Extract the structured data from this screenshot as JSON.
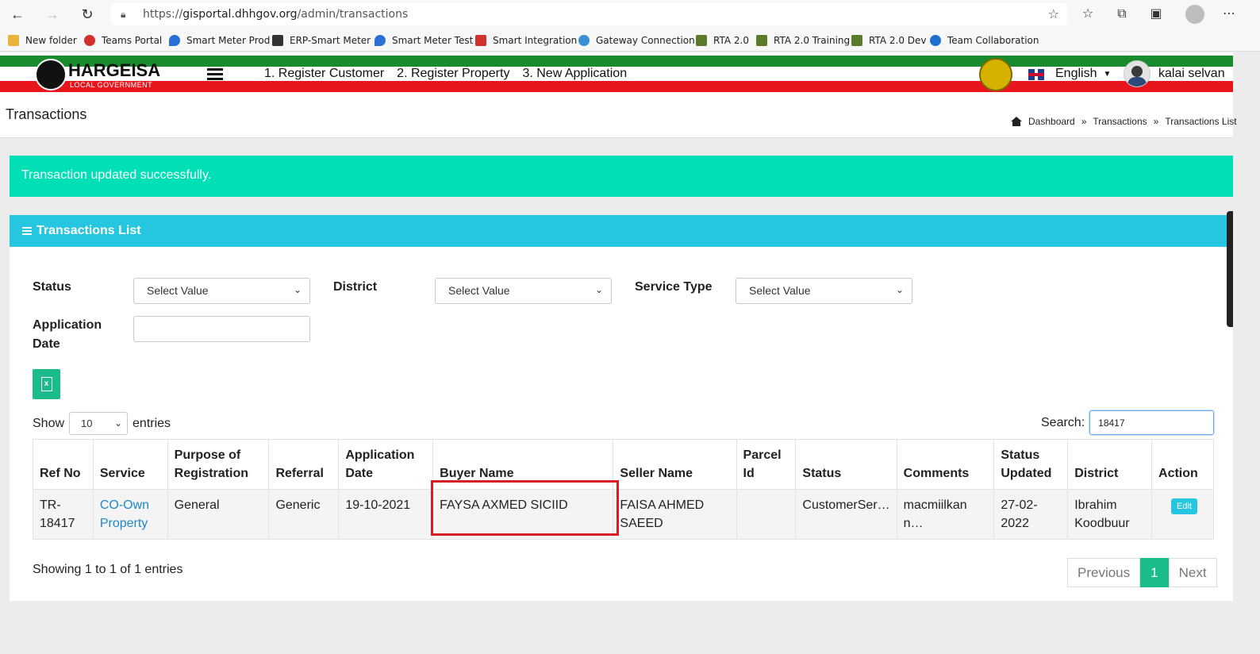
{
  "browser": {
    "url_prefix": "https://",
    "url_host": "gisportal.dhhgov.org",
    "url_path": "/admin/transactions",
    "bookmarks": [
      {
        "label": "New folder",
        "color": "#e8b43c"
      },
      {
        "label": "Teams Portal",
        "color": "#d0312d"
      },
      {
        "label": "Smart Meter Prod",
        "color": "#2a6fd6"
      },
      {
        "label": "ERP-Smart Meter",
        "color": "#333333"
      },
      {
        "label": "Smart Meter Test",
        "color": "#2a6fd6"
      },
      {
        "label": "Smart Integration",
        "color": "#d0312d"
      },
      {
        "label": "Gateway Connection",
        "color": "#3a8fd6"
      },
      {
        "label": "RTA 2.0",
        "color": "#5b7a2a"
      },
      {
        "label": "RTA 2.0 Training",
        "color": "#5b7a2a"
      },
      {
        "label": "RTA 2.0 Dev",
        "color": "#5b7a2a"
      },
      {
        "label": "Team Collaboration",
        "color": "#1e6fd0"
      }
    ]
  },
  "header": {
    "logo_title": "HARGEISA",
    "logo_subtitle": "LOCAL GOVERNMENT",
    "menu": [
      "1. Register Customer",
      "2. Register Property",
      "3. New Application"
    ],
    "language": "English",
    "user_name": "kalai selvan"
  },
  "page": {
    "title": "Transactions",
    "breadcrumb": [
      "Dashboard",
      "»",
      "Transactions",
      "»",
      "Transactions List"
    ]
  },
  "alert": {
    "message": "Transaction updated successfully.",
    "color": "#00dfb6"
  },
  "card": {
    "title": "Transactions List",
    "filters": {
      "status_label": "Status",
      "status_value": "Select Value",
      "district_label": "District",
      "district_value": "Select Value",
      "service_type_label": "Service Type",
      "service_type_value": "Select Value",
      "application_date_label_1": "Application",
      "application_date_label_2": "Date",
      "application_date_value": ""
    },
    "show_label": "Show",
    "show_value": "10",
    "entries_label": "entries",
    "search_label": "Search:",
    "search_value": "18417",
    "columns": [
      "Ref No",
      "Service",
      "Purpose of Registration",
      "Referral",
      "Application Date",
      "Buyer Name",
      "Seller Name",
      "Parcel Id",
      "Status",
      "Comments",
      "Status Updated",
      "District",
      "Action"
    ],
    "rows": [
      {
        "ref_no": "TR-18417",
        "service": "CO-Own Property",
        "purpose": "General",
        "referral": "Generic",
        "application_date": "19-10-2021",
        "buyer_name": "FAYSA AXMED SICIID",
        "seller_name": "FAISA AHMED SAEED",
        "parcel_id": "",
        "status": "CustomerSer…",
        "comments": "macmiilkan n…",
        "status_updated": "27-02-2022",
        "district": "Ibrahim Koodbuur",
        "action": "Edit"
      }
    ],
    "showing_text": "Showing 1 to 1 of 1 entries",
    "pager": {
      "previous": "Previous",
      "current": "1",
      "next": "Next"
    }
  }
}
